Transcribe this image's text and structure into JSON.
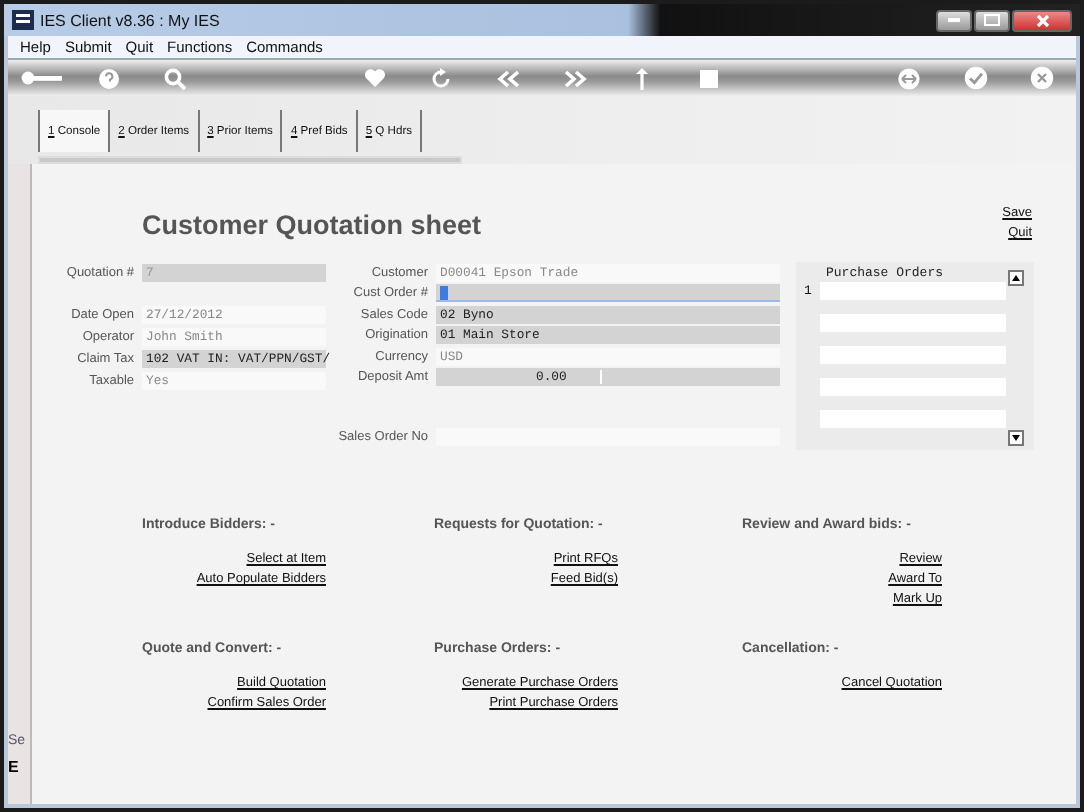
{
  "window": {
    "title": "IES Client v8.36 : My IES"
  },
  "menu": [
    "Help",
    "Submit",
    "Quit",
    "Functions",
    "Commands"
  ],
  "tabs": [
    {
      "label": "1 Console",
      "selected": true
    },
    {
      "label": "2 Order Items",
      "selected": false
    },
    {
      "label": "3 Prior Items",
      "selected": false
    },
    {
      "label": "4 Pref Bids",
      "selected": false
    },
    {
      "label": "5 Q Hdrs",
      "selected": false
    }
  ],
  "sheet": {
    "title": "Customer Quotation sheet",
    "actions": [
      "Save",
      "Quit"
    ]
  },
  "left_fields": [
    {
      "label": "Quotation #",
      "value": "7",
      "kind": "dim",
      "focused": false
    },
    {
      "label": "Date Open",
      "value": "27/12/2012",
      "kind": "plain",
      "focused": false
    },
    {
      "label": "Operator",
      "value": "John Smith",
      "kind": "plain",
      "focused": false
    },
    {
      "label": "Claim Tax",
      "value": "102 VAT IN: VAT/PPN/GST/",
      "kind": "shaded",
      "focused": false
    },
    {
      "label": "Taxable",
      "value": "Yes",
      "kind": "plain",
      "focused": false
    }
  ],
  "customer_fields": [
    {
      "label": "Customer",
      "value": "D00041 Epson Trade",
      "kind": "plain",
      "focused": false
    },
    {
      "label": "Cust Order #",
      "kind": "shaded",
      "focused": true
    },
    {
      "label": "Sales Code",
      "value": "02 Byno",
      "kind": "shaded",
      "focused": false
    },
    {
      "label": "Origination",
      "value": "01 Main Store",
      "kind": "shaded",
      "focused": false
    },
    {
      "label": "Currency",
      "value": "USD",
      "kind": "plain",
      "focused": false
    },
    {
      "label": "Deposit Amt",
      "value": "0.00",
      "kind": "amount",
      "focused": false
    }
  ],
  "sales_order_field": {
    "label": "Sales Order No",
    "kind": "plain",
    "focused": false
  },
  "purchase_orders": {
    "header": "Purchase Orders",
    "row_numbers": [
      "1"
    ]
  },
  "sections": [
    {
      "heading": "Introduce Bidders: -",
      "links": [
        "Select at Item",
        "Auto Populate Bidders"
      ]
    },
    {
      "heading": "Requests for Quotation: -",
      "links": [
        "Print RFQs",
        "Feed Bid(s)"
      ]
    },
    {
      "heading": "Review and Award bids: -",
      "links": [
        "Review",
        "Award To",
        "Mark Up"
      ]
    },
    {
      "heading": "Quote and Convert: -",
      "links": [
        "Build Quotation",
        "Confirm Sales Order"
      ]
    },
    {
      "heading": "Purchase Orders: -",
      "links": [
        "Generate Purchase Orders",
        "Print Purchase Orders"
      ]
    },
    {
      "heading": "Cancellation: -",
      "links": [
        "Cancel Quotation"
      ]
    }
  ],
  "left_strip": [
    "Se",
    "E"
  ]
}
